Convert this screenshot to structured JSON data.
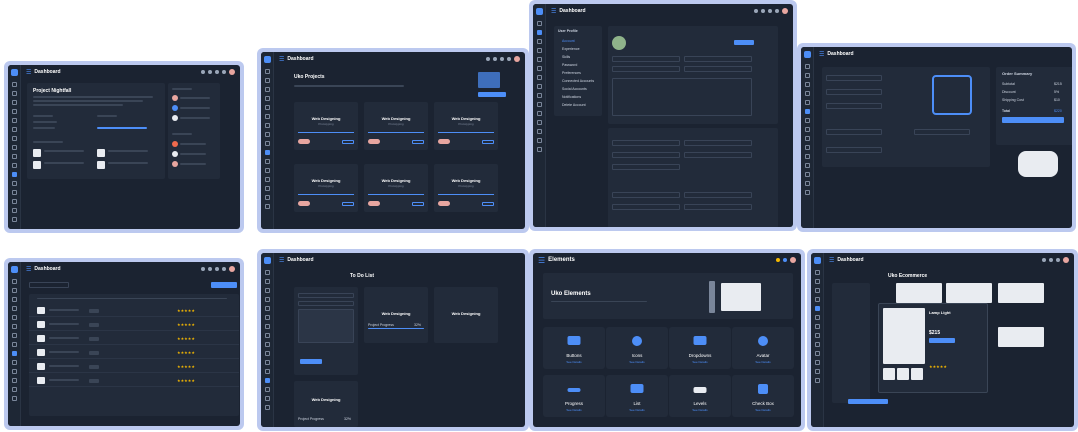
{
  "dashboard_title": "Dashboard",
  "elements_title": "Elements",
  "colors": {
    "accent": "#4d8ef7",
    "bg": "#1b2331",
    "panel": "#222b3a",
    "frame": "#bcc9ef",
    "star": "#f5b800"
  },
  "projects": {
    "title": "Uko Projects",
    "card_title": "Web Designing",
    "card_sub": "Prototyping",
    "progress_label": "Project Progress",
    "progress_value": "32%"
  },
  "todo": {
    "title": "To Do List",
    "task_title": "Web Designing",
    "progress_label": "Project Progress",
    "progress_value": "32%"
  },
  "order_summary": {
    "title": "Order Summary",
    "rows": [
      {
        "label": "Subtotal",
        "value": "$215"
      },
      {
        "label": "Discount",
        "value": "5%"
      },
      {
        "label": "Shipping Cost",
        "value": "$10"
      },
      {
        "label": "Total",
        "value": "$220"
      }
    ]
  },
  "elements_page": {
    "hero_title": "Uko Elements",
    "cards": [
      {
        "label": "Buttons",
        "link": "See Details"
      },
      {
        "label": "Icons",
        "link": "See Details"
      },
      {
        "label": "Dropdowns",
        "link": "See Details"
      },
      {
        "label": "Avatar",
        "link": "See Details"
      },
      {
        "label": "Progress",
        "link": "See Details"
      },
      {
        "label": "List",
        "link": "See Details"
      },
      {
        "label": "Levels",
        "link": "See Details"
      },
      {
        "label": "Check Box",
        "link": "See Details"
      }
    ]
  },
  "ecommerce": {
    "title": "Uko Ecommerce",
    "product": "Lamp Light",
    "price": "$215"
  },
  "project_detail": {
    "title": "Project Nightfall"
  },
  "account": {
    "section": "User Profile",
    "menu": [
      "Account",
      "Experience",
      "Skills",
      "Password",
      "Preferences",
      "Connected Accounts",
      "Social Accounts",
      "Notifications",
      "Delete Account"
    ]
  }
}
